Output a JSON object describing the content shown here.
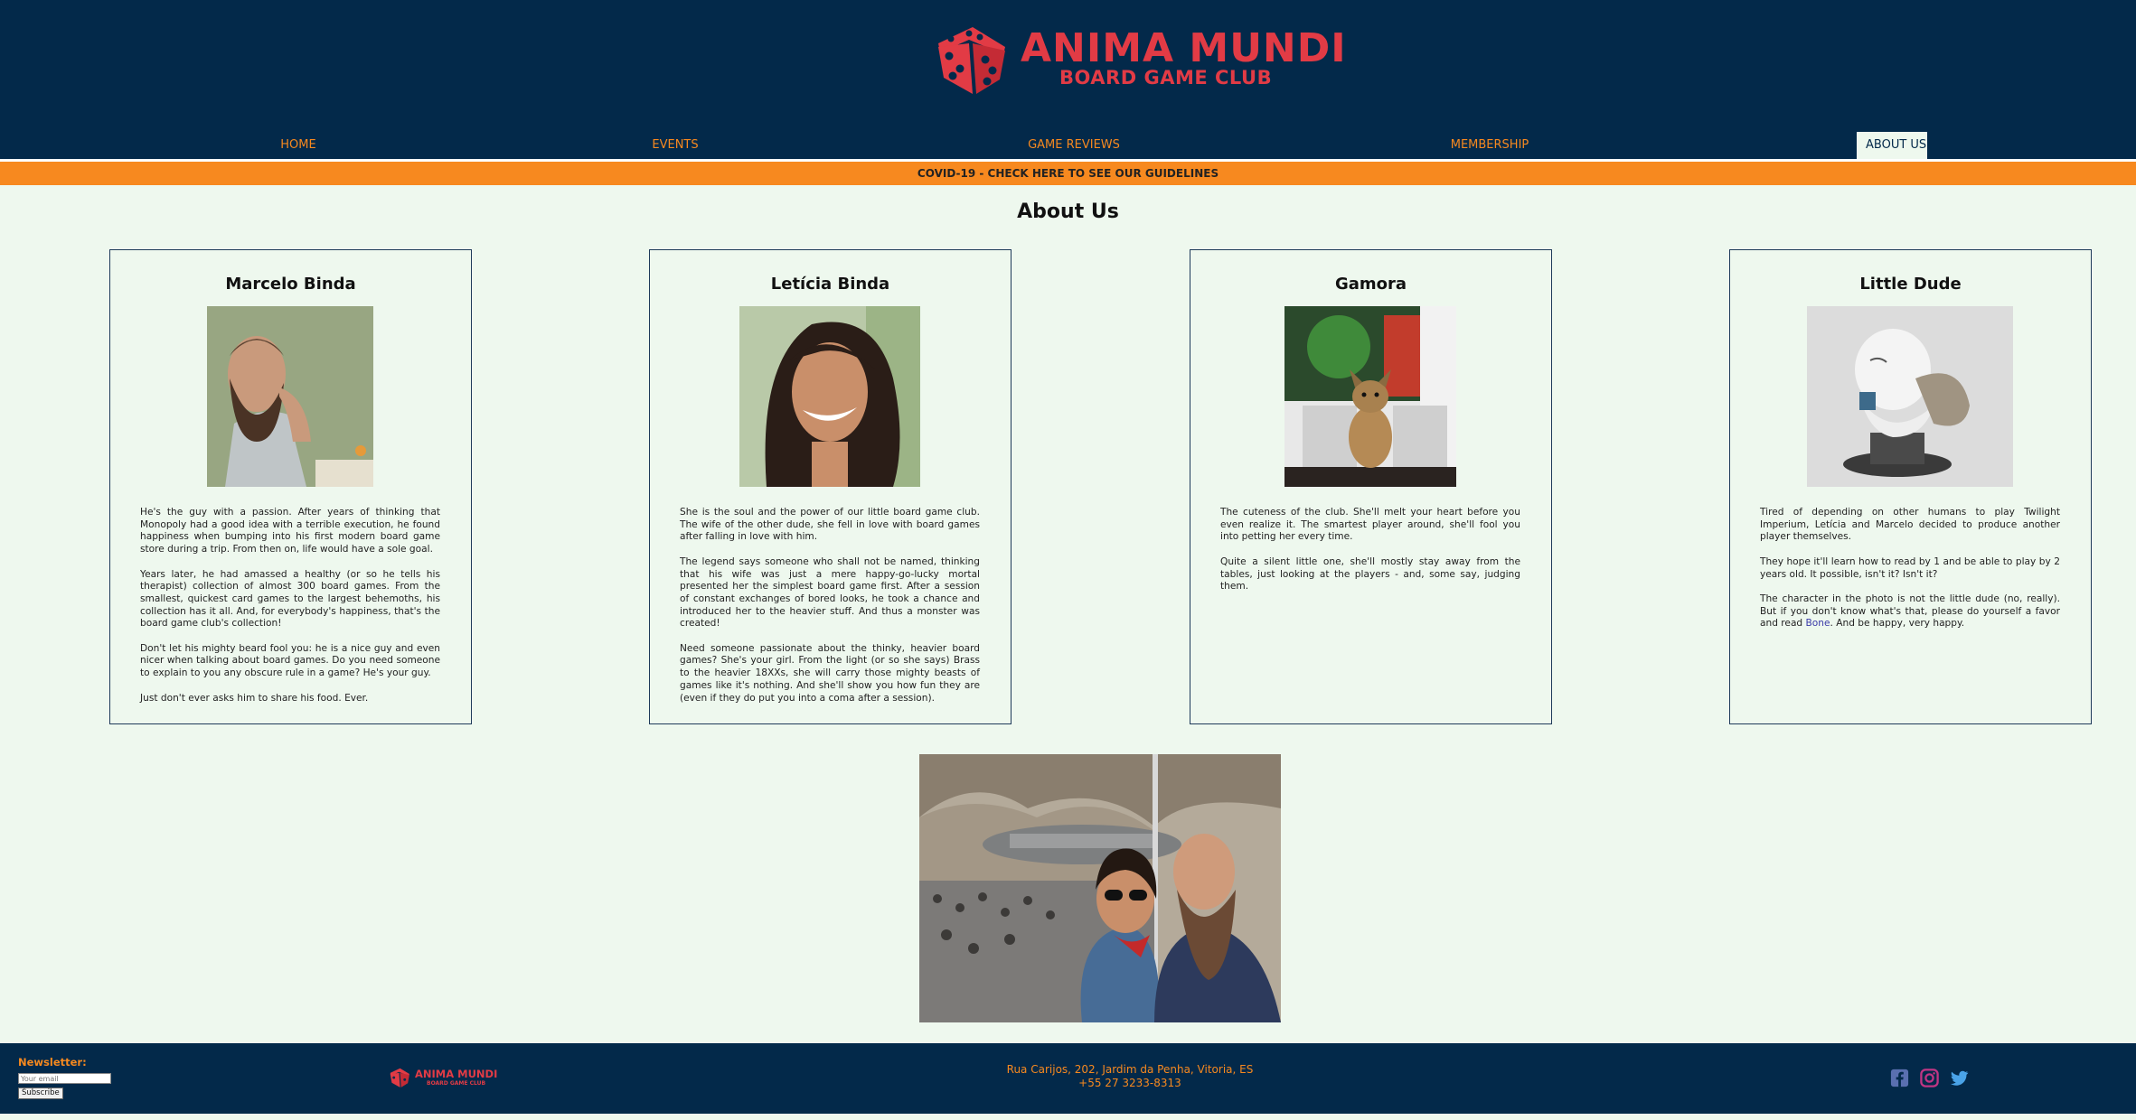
{
  "brand": {
    "title": "ANIMA MUNDI",
    "subtitle": "BOARD GAME CLUB",
    "color": "#e23b45"
  },
  "nav": {
    "items": [
      {
        "label": "HOME",
        "active": false
      },
      {
        "label": "EVENTS",
        "active": false
      },
      {
        "label": "GAME REVIEWS",
        "active": false
      },
      {
        "label": "MEMBERSHIP",
        "active": false
      },
      {
        "label": "ABOUT US",
        "active": true
      }
    ]
  },
  "banner": {
    "text": "COVID-19 - CHECK HERE TO SEE OUR GUIDELINES"
  },
  "page": {
    "title": "About Us"
  },
  "members": [
    {
      "name": "Marcelo Binda",
      "paragraphs": [
        "He's the guy with a passion. After years of thinking that Monopoly had a good idea with a terrible execution, he found happiness when bumping into his first modern board game store during a trip. From then on, life would have a sole goal.",
        "Years later, he had amassed a healthy (or so he tells his therapist) collection of almost 300 board games. From the smallest, quickest card games to the largest behemoths, his collection has it all. And, for everybody's happiness, that's the board game club's collection!",
        "Don't let his mighty beard fool you: he is a nice guy and even nicer when talking about board games. Do you need someone to explain to you any obscure rule in a game? He's your guy.",
        "Just don't ever asks him to share his food. Ever."
      ]
    },
    {
      "name": "Letícia Binda",
      "paragraphs": [
        "She is the soul and the power of our little board game club. The wife of the other dude, she fell in love with board games after falling in love with him.",
        "The legend says someone who shall not be named, thinking that his wife was just a mere happy-go-lucky mortal presented her the simplest board game first. After a session of constant exchanges of bored looks, he took a chance and introduced her to the heavier stuff. And thus a monster was created!",
        "Need someone passionate about the thinky, heavier board games? She's your girl. From the light (or so she says) Brass to the heavier 18XXs, she will carry those mighty beasts of games like it's nothing. And she'll show you how fun they are (even if they do put you into a coma after a session)."
      ]
    },
    {
      "name": "Gamora",
      "paragraphs": [
        "The cuteness of the club. She'll melt your heart before you even realize it. The smartest player around, she'll fool you into petting her every time.",
        "Quite a silent little one, she'll mostly stay away from the tables, just looking at the players - and, some say, judging them."
      ]
    },
    {
      "name": "Little Dude",
      "paragraphs": [
        "Tired of depending on other humans to play Twilight Imperium, Letícia and Marcelo decided to produce another player themselves.",
        "They hope it'll learn how to read by 1 and be able to play by 2 years old. It possible, isn't it? Isn't it?"
      ],
      "last_paragraph": {
        "before": "The character in the photo is not the little dude (no, really). But if you don't know what's that, please do yourself a favor and read ",
        "link": "Bone",
        "after": ". And be happy, very happy."
      }
    }
  ],
  "footer": {
    "newsletter_label": "Newsletter:",
    "email_placeholder": "Your email",
    "subscribe_label": "Subscribe",
    "address_line1": "Rua Carijos, 202, Jardim da Penha, Vitoria, ES",
    "address_line2": "+55 27 3233-8313",
    "social": [
      "facebook-icon",
      "instagram-icon",
      "twitter-icon"
    ]
  },
  "colors": {
    "navy": "#03294a",
    "orange": "#f7891f",
    "background": "#eef8ee",
    "red": "#e23b45"
  }
}
